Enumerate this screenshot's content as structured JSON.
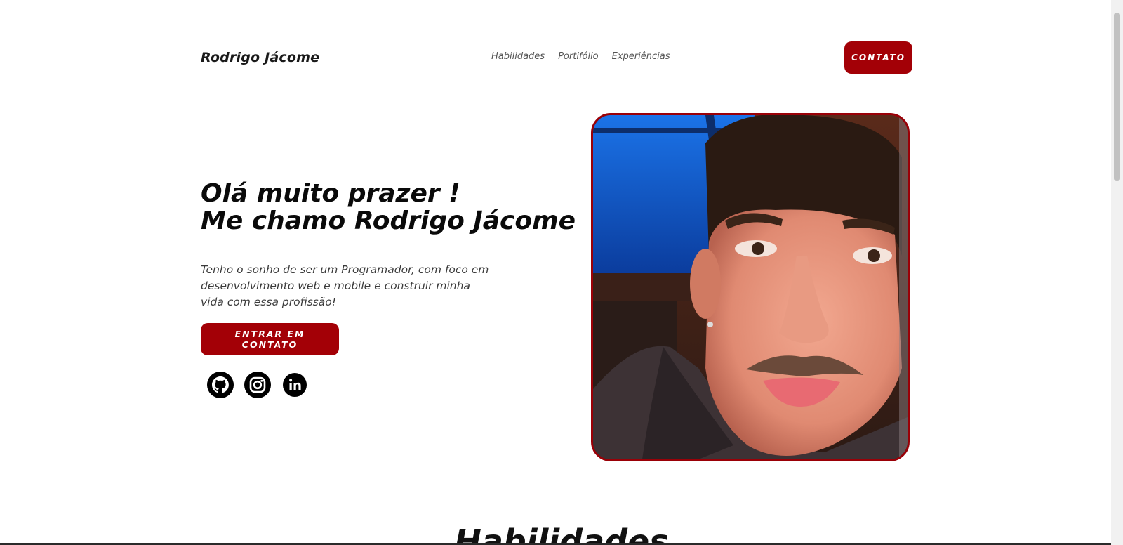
{
  "header": {
    "brand": "Rodrigo Jácome",
    "nav": [
      "Habilidades",
      "Portifólio",
      "Experiências"
    ],
    "contact_label": "CONTATO"
  },
  "hero": {
    "title_line1": "Olá muito prazer !",
    "title_line2": "Me chamo Rodrigo Jácome",
    "text": "Tenho o sonho de ser um Programador, com foco em desenvolvimento web e mobile e construir minha vida com essa profissão!",
    "cta_label": "ENTRAR EM CONTATO",
    "socials": [
      {
        "icon": "github-icon"
      },
      {
        "icon": "instagram-icon"
      },
      {
        "icon": "linkedin-icon"
      }
    ],
    "photo": {
      "icon": "profile-photo"
    }
  },
  "sections": {
    "next_title": "Habilidades"
  },
  "colors": {
    "accent": "#a30006",
    "photo_border": "#9a0007",
    "text": "#0a0a0a",
    "background": "#ffffff"
  }
}
